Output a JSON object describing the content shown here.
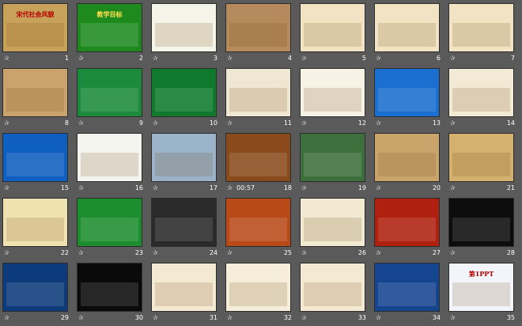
{
  "slides": [
    {
      "number": "1",
      "title": "宋代社会风貌",
      "bg": "#c8a25a",
      "timer": ""
    },
    {
      "number": "2",
      "title": "教学目标",
      "bg": "#1e8a1e",
      "timer": ""
    },
    {
      "number": "3",
      "title": "",
      "bg": "#f4f4e8",
      "timer": ""
    },
    {
      "number": "4",
      "title": "",
      "bg": "#b58a5c",
      "timer": ""
    },
    {
      "number": "5",
      "title": "",
      "bg": "#f1e3c3",
      "timer": ""
    },
    {
      "number": "6",
      "title": "",
      "bg": "#f1e3c3",
      "timer": ""
    },
    {
      "number": "7",
      "title": "",
      "bg": "#f1e3c3",
      "timer": ""
    },
    {
      "number": "8",
      "title": "",
      "bg": "#c9a36b",
      "timer": ""
    },
    {
      "number": "9",
      "title": "",
      "bg": "#1b8a3a",
      "timer": ""
    },
    {
      "number": "10",
      "title": "",
      "bg": "#0f7a2e",
      "timer": ""
    },
    {
      "number": "11",
      "title": "",
      "bg": "#efe7d2",
      "timer": ""
    },
    {
      "number": "12",
      "title": "",
      "bg": "#f7f2e6",
      "timer": ""
    },
    {
      "number": "13",
      "title": "",
      "bg": "#1a6fd0",
      "timer": ""
    },
    {
      "number": "14",
      "title": "",
      "bg": "#f3ead6",
      "timer": ""
    },
    {
      "number": "15",
      "title": "",
      "bg": "#0e5fbf",
      "timer": ""
    },
    {
      "number": "16",
      "title": "",
      "bg": "#f4f4ef",
      "timer": ""
    },
    {
      "number": "17",
      "title": "",
      "bg": "#9ab3c8",
      "timer": ""
    },
    {
      "number": "18",
      "title": "",
      "bg": "#8a4a1c",
      "timer": "00:57"
    },
    {
      "number": "19",
      "title": "",
      "bg": "#3d6f3d",
      "timer": ""
    },
    {
      "number": "20",
      "title": "",
      "bg": "#c9a56c",
      "timer": ""
    },
    {
      "number": "21",
      "title": "",
      "bg": "#d4b16e",
      "timer": ""
    },
    {
      "number": "22",
      "title": "",
      "bg": "#efe2b0",
      "timer": ""
    },
    {
      "number": "23",
      "title": "",
      "bg": "#1d8e2e",
      "timer": ""
    },
    {
      "number": "24",
      "title": "",
      "bg": "#2a2a2a",
      "timer": ""
    },
    {
      "number": "25",
      "title": "",
      "bg": "#b84a18",
      "timer": ""
    },
    {
      "number": "26",
      "title": "",
      "bg": "#f1e9d2",
      "timer": ""
    },
    {
      "number": "27",
      "title": "",
      "bg": "#b0200e",
      "timer": ""
    },
    {
      "number": "28",
      "title": "",
      "bg": "#0c0c0c",
      "timer": ""
    },
    {
      "number": "29",
      "title": "",
      "bg": "#0c3a7a",
      "timer": ""
    },
    {
      "number": "30",
      "title": "",
      "bg": "#0a0a0a",
      "timer": ""
    },
    {
      "number": "31",
      "title": "",
      "bg": "#f4ead4",
      "timer": ""
    },
    {
      "number": "32",
      "title": "",
      "bg": "#f6eedb",
      "timer": ""
    },
    {
      "number": "33",
      "title": "",
      "bg": "#f4ead4",
      "timer": ""
    },
    {
      "number": "34",
      "title": "",
      "bg": "#15458f",
      "timer": ""
    },
    {
      "number": "35",
      "title": "第1PPT",
      "bg": "#f2f6fb",
      "timer": ""
    }
  ],
  "star_glyph": "✰"
}
